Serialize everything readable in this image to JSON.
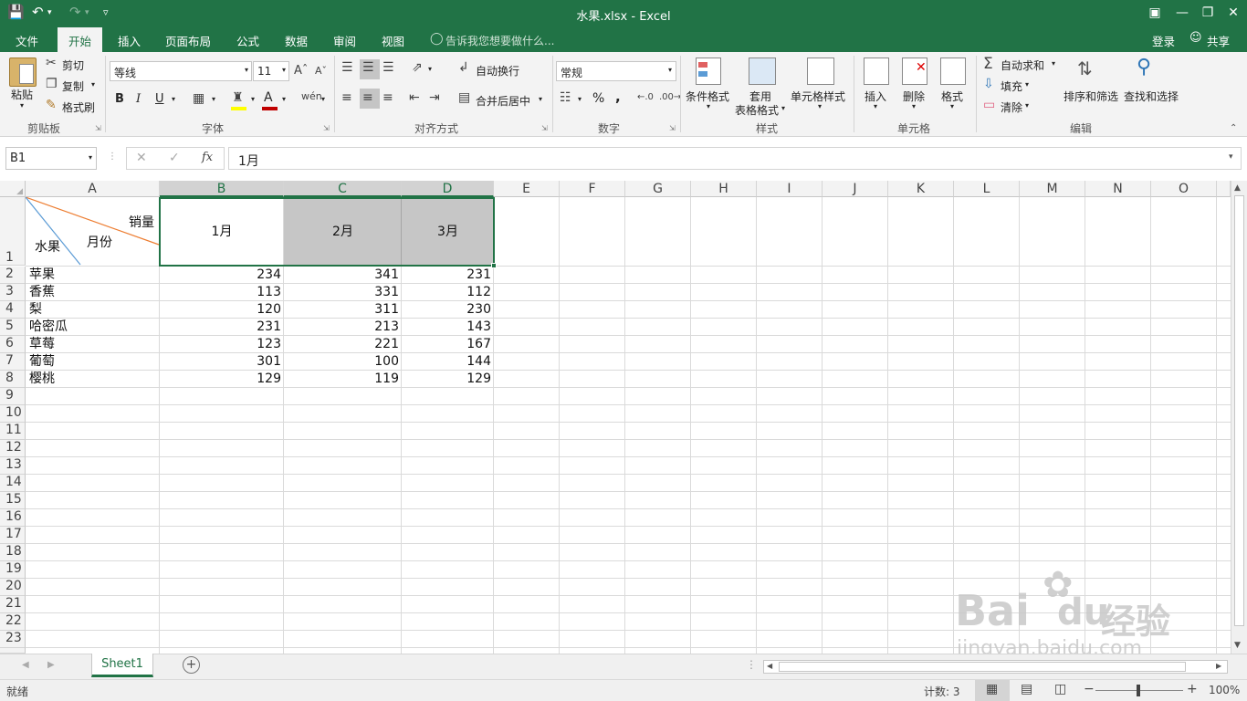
{
  "titlebar": {
    "title": "水果.xlsx - Excel",
    "qat": {
      "save_icon": "save-icon",
      "undo_icon": "undo-icon",
      "redo_icon": "redo-icon",
      "customize_icon": "customize-icon"
    },
    "window": {
      "ribbon_options_icon": "ribbon-display-icon",
      "minimize_icon": "minimize-icon",
      "restore_icon": "restore-icon",
      "close_icon": "close-icon"
    }
  },
  "tabs": [
    {
      "label": "文件"
    },
    {
      "label": "开始"
    },
    {
      "label": "插入"
    },
    {
      "label": "页面布局"
    },
    {
      "label": "公式"
    },
    {
      "label": "数据"
    },
    {
      "label": "审阅"
    },
    {
      "label": "视图"
    }
  ],
  "tell_me": "告诉我您想要做什么...",
  "account": {
    "login": "登录",
    "share": "共享"
  },
  "ribbon": {
    "clipboard": {
      "paste": "粘贴",
      "cut": "剪切",
      "copy": "复制",
      "format_painter": "格式刷",
      "label": "剪贴板"
    },
    "font": {
      "name": "等线",
      "size": "11",
      "bold": "B",
      "italic": "I",
      "underline": "U",
      "label": "字体"
    },
    "alignment": {
      "wrap": "自动换行",
      "merge": "合并后居中",
      "label": "对齐方式"
    },
    "number": {
      "format": "常规",
      "percent": "%",
      "comma": ",",
      "label": "数字"
    },
    "styles": {
      "conditional": "条件格式",
      "table_1": "套用",
      "table_2": "表格格式",
      "cell_styles": "单元格样式",
      "label": "样式"
    },
    "cells": {
      "insert": "插入",
      "delete": "删除",
      "format": "格式",
      "label": "单元格"
    },
    "editing": {
      "autosum": "自动求和",
      "fill": "填充",
      "clear": "清除",
      "sort": "排序和筛选",
      "find": "查找和选择",
      "label": "编辑"
    }
  },
  "formula_bar": {
    "name_box": "B1",
    "fx": "fx",
    "value": "1月"
  },
  "columns": [
    "A",
    "B",
    "C",
    "D",
    "E",
    "F",
    "G",
    "H",
    "I",
    "J",
    "K",
    "L",
    "M",
    "N",
    "O"
  ],
  "rows": [
    "1",
    "2",
    "3",
    "4",
    "5",
    "6",
    "7",
    "8",
    "9",
    "10",
    "11",
    "12",
    "13",
    "14",
    "15",
    "16",
    "17",
    "18",
    "19",
    "20",
    "21",
    "22",
    "23"
  ],
  "header_cell": {
    "sales": "销量",
    "month": "月份",
    "fruit": "水果"
  },
  "months": [
    "1月",
    "2月",
    "3月"
  ],
  "table": [
    {
      "fruit": "苹果",
      "m1": "234",
      "m2": "341",
      "m3": "231"
    },
    {
      "fruit": "香蕉",
      "m1": "113",
      "m2": "331",
      "m3": "112"
    },
    {
      "fruit": "梨",
      "m1": "120",
      "m2": "311",
      "m3": "230"
    },
    {
      "fruit": "哈密瓜",
      "m1": "231",
      "m2": "213",
      "m3": "143"
    },
    {
      "fruit": "草莓",
      "m1": "123",
      "m2": "221",
      "m3": "167"
    },
    {
      "fruit": "葡萄",
      "m1": "301",
      "m2": "100",
      "m3": "144"
    },
    {
      "fruit": "樱桃",
      "m1": "129",
      "m2": "119",
      "m3": "129"
    }
  ],
  "sheet_tabs": [
    "Sheet1"
  ],
  "status": {
    "ready": "就绪",
    "count": "计数: 3",
    "zoom": "100%"
  },
  "watermark": {
    "line1": "Bai",
    "line2": "du",
    "line3": "经验",
    "url": "jingyan.baidu.com"
  },
  "colors": {
    "accent": "#217346",
    "selected_fill": "#c6c6c6",
    "diag_orange": "#ed7d31",
    "diag_blue": "#5b9bd5"
  }
}
